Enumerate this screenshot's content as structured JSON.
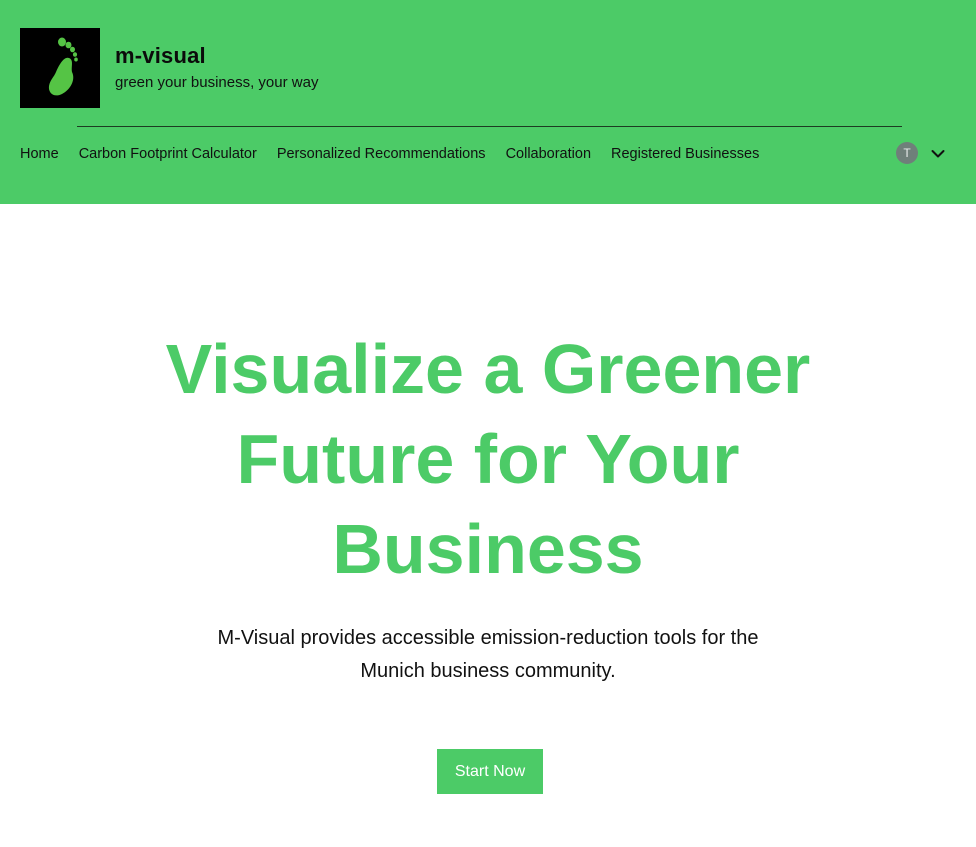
{
  "brand": {
    "logo_icon": "footprint-icon",
    "name": "m-visual",
    "tagline": "green your business, your way"
  },
  "nav": {
    "items": [
      {
        "label": "Home"
      },
      {
        "label": "Carbon Footprint Calculator"
      },
      {
        "label": "Personalized Recommendations"
      },
      {
        "label": "Collaboration"
      },
      {
        "label": "Registered Businesses"
      }
    ]
  },
  "user": {
    "avatar_initial": "T",
    "menu_icon": "chevron-down-icon"
  },
  "hero": {
    "title": "Visualize a Greener Future for Your Business",
    "subtitle": "M-Visual provides accessible emission-reduction tools for the Munich business community.",
    "cta_label": "Start Now"
  },
  "colors": {
    "brand_green": "#4ccb67",
    "logo_bg": "#000000",
    "avatar_bg": "#6f7f7a"
  }
}
